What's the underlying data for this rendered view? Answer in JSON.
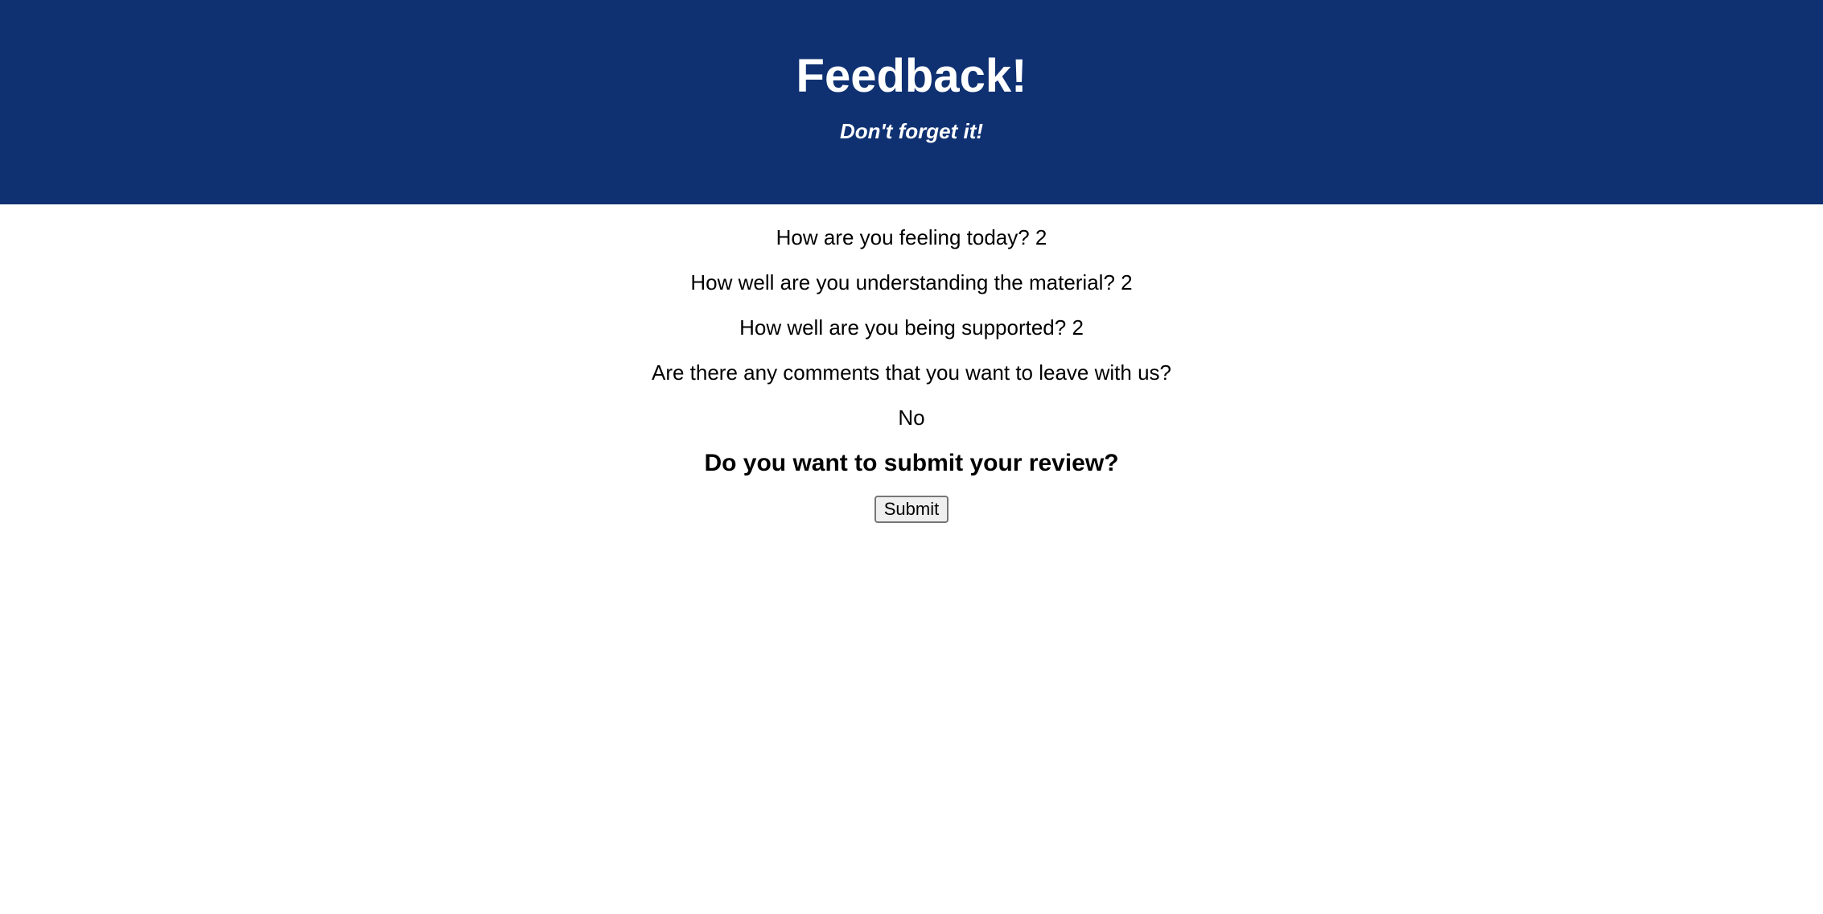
{
  "header": {
    "title": "Feedback!",
    "subtitle": "Don't forget it!",
    "background_color": "#0f3172",
    "text_color": "#ffffff"
  },
  "feedback": {
    "feeling": "How are you feeling today? 2",
    "understanding": "How well are you understanding the material? 2",
    "support": "How well are you being supported? 2",
    "comments_question": "Are there any comments that you want to leave with us?",
    "comments_answer": "No"
  },
  "submit_section": {
    "prompt": "Do you want to submit your review?",
    "button_label": "Submit"
  }
}
